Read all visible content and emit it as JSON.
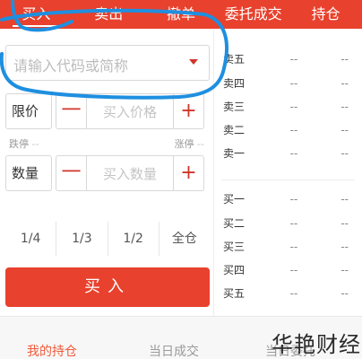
{
  "top_tabs": [
    "买入",
    "卖出",
    "撤单",
    "委托成交",
    "持仓"
  ],
  "active_top_tab": 0,
  "code_input": {
    "placeholder": "请输入代码或简称"
  },
  "price": {
    "label": "限价",
    "placeholder": "买入价格",
    "minus": "一",
    "plus": "+"
  },
  "limits": {
    "down_label": "跌停",
    "down_value": "--",
    "up_label": "涨停",
    "up_value": "--"
  },
  "quantity": {
    "label": "数量",
    "placeholder": "买入数量",
    "minus": "一",
    "plus": "+"
  },
  "fractions": [
    "1/4",
    "1/3",
    "1/2",
    "全仓"
  ],
  "buy_button": "买入",
  "order_book": {
    "asks": [
      {
        "name": "卖五",
        "price": "--",
        "qty": "--"
      },
      {
        "name": "卖四",
        "price": "--",
        "qty": "--"
      },
      {
        "name": "卖三",
        "price": "--",
        "qty": "--"
      },
      {
        "name": "卖二",
        "price": "--",
        "qty": "--"
      },
      {
        "name": "卖一",
        "price": "--",
        "qty": "--"
      }
    ],
    "bids": [
      {
        "name": "买一",
        "price": "--",
        "qty": "--"
      },
      {
        "name": "买二",
        "price": "--",
        "qty": "--"
      },
      {
        "name": "买三",
        "price": "--",
        "qty": "--"
      },
      {
        "name": "买四",
        "price": "--",
        "qty": "--"
      },
      {
        "name": "买五",
        "price": "--",
        "qty": "--"
      }
    ]
  },
  "bottom_tabs": [
    "我的持仓",
    "当日成交",
    "当日委托"
  ],
  "watermark": "华艳财经",
  "colors": {
    "primary": "#e8412d",
    "accent_text": "#d0352a",
    "annotation": "#1e8fe0"
  }
}
